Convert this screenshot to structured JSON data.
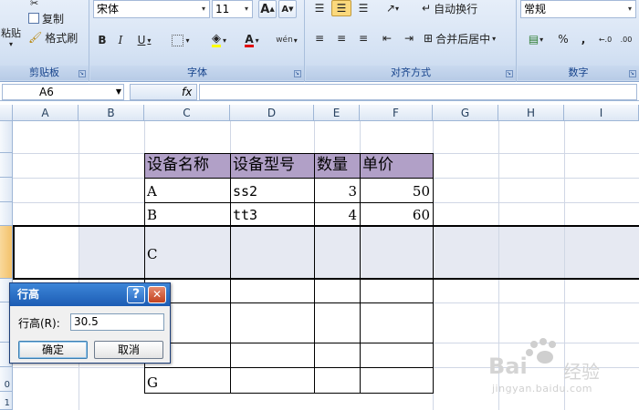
{
  "ribbon": {
    "clipboard": {
      "label": "剪贴板",
      "paste": "粘贴",
      "copy": "复制",
      "format_painter": "格式刷"
    },
    "font": {
      "label": "字体",
      "font_name": "宋体",
      "font_size": "11",
      "grow_font": "A",
      "shrink_font": "A",
      "bold": "B",
      "italic": "I",
      "underline": "U",
      "font_color": "A",
      "phonetic": "wén"
    },
    "alignment": {
      "label": "对齐方式",
      "wrap_text": "自动换行",
      "merge_center": "合并后居中"
    },
    "number": {
      "label": "数字",
      "format": "常规",
      "percent": "%",
      "comma": ","
    }
  },
  "formula_bar": {
    "name_box": "A6",
    "fx": "fx"
  },
  "grid": {
    "columns": [
      "A",
      "B",
      "C",
      "D",
      "E",
      "F",
      "G",
      "H",
      "I"
    ],
    "row_numbers": [
      "0",
      "1"
    ],
    "header_row": [
      "设备名称",
      "设备型号",
      "数量",
      "单价"
    ],
    "rows": [
      {
        "name": "A",
        "model": "ss2",
        "qty": "3",
        "price": "50"
      },
      {
        "name": "B",
        "model": "tt3",
        "qty": "4",
        "price": "60"
      },
      {
        "name": "C",
        "model": "",
        "qty": "",
        "price": ""
      },
      {
        "name": "",
        "model": "",
        "qty": "",
        "price": ""
      },
      {
        "name": "",
        "model": "",
        "qty": "",
        "price": ""
      },
      {
        "name": "",
        "model": "",
        "qty": "",
        "price": ""
      },
      {
        "name": "G",
        "model": "",
        "qty": "",
        "price": ""
      }
    ],
    "header_fill": "#b1a0c7",
    "selection_fill": "#e6e9f2"
  },
  "dialog": {
    "title": "行高",
    "help": "?",
    "close": "✕",
    "field_label": "行高(R):",
    "field_value": "30.5",
    "ok": "确定",
    "cancel": "取消"
  },
  "watermark": {
    "brand_a": "Bai",
    "brand_b": "经验",
    "url": "jingyan.baidu.com"
  }
}
